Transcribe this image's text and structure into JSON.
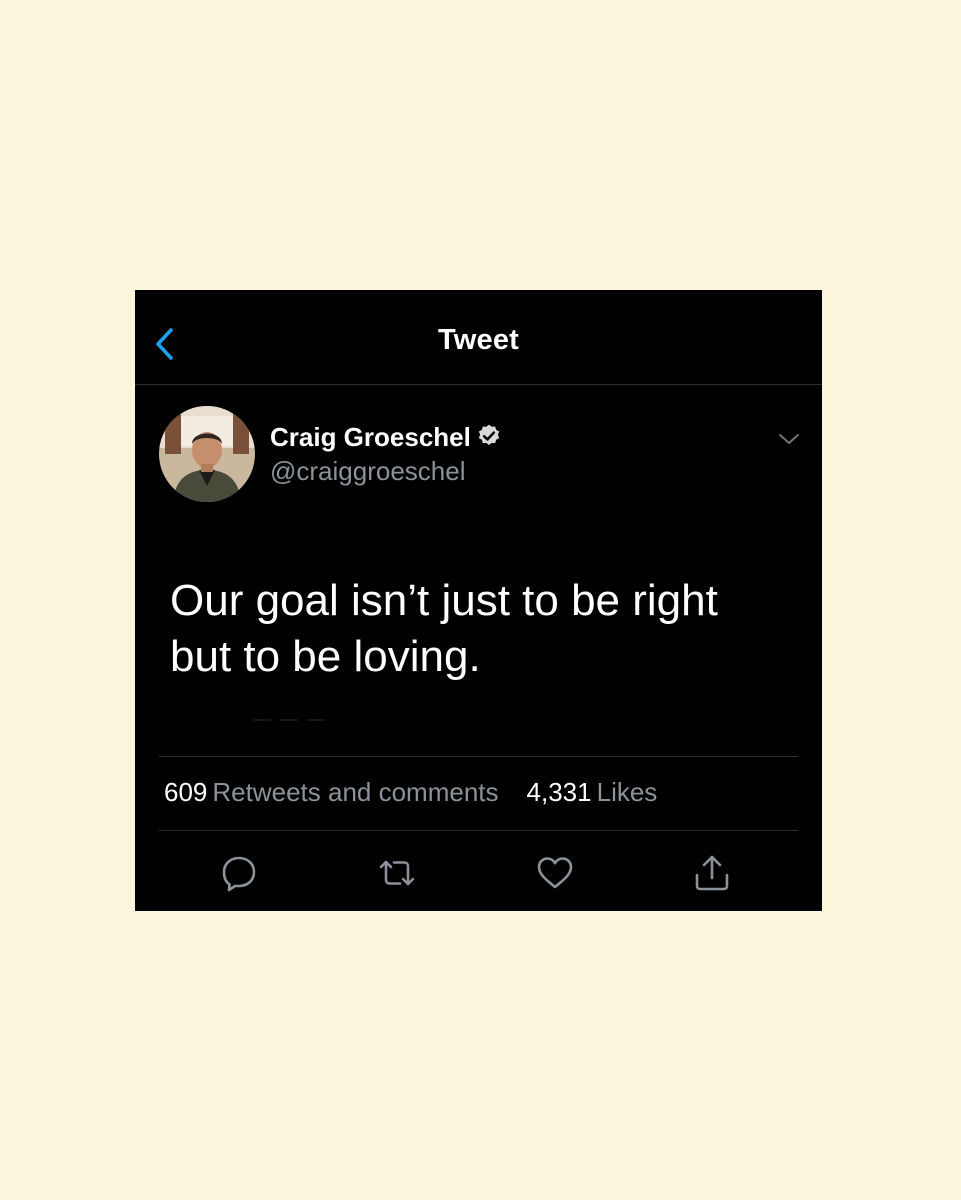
{
  "header": {
    "title": "Tweet",
    "back_icon": "chevron-left-icon",
    "accent_color": "#1da1f2"
  },
  "author": {
    "name": "Craig Groeschel",
    "handle": "@craiggroeschel",
    "verified": true,
    "avatar_icon": "avatar"
  },
  "tweet": {
    "text": "Our goal isn’t just to be right\nbut to be loving."
  },
  "stats": {
    "retweets_count": "609",
    "retweets_label": "Retweets and comments",
    "likes_count": "4,331",
    "likes_label": "Likes"
  },
  "actions": [
    {
      "name": "reply",
      "icon": "comment-icon"
    },
    {
      "name": "retweet",
      "icon": "retweet-icon"
    },
    {
      "name": "like",
      "icon": "heart-icon"
    },
    {
      "name": "share",
      "icon": "share-icon"
    }
  ],
  "colors": {
    "page_background": "#fbf5dc",
    "card_background": "#000000",
    "secondary_text": "#8b9299",
    "divider": "#2a2d30"
  }
}
